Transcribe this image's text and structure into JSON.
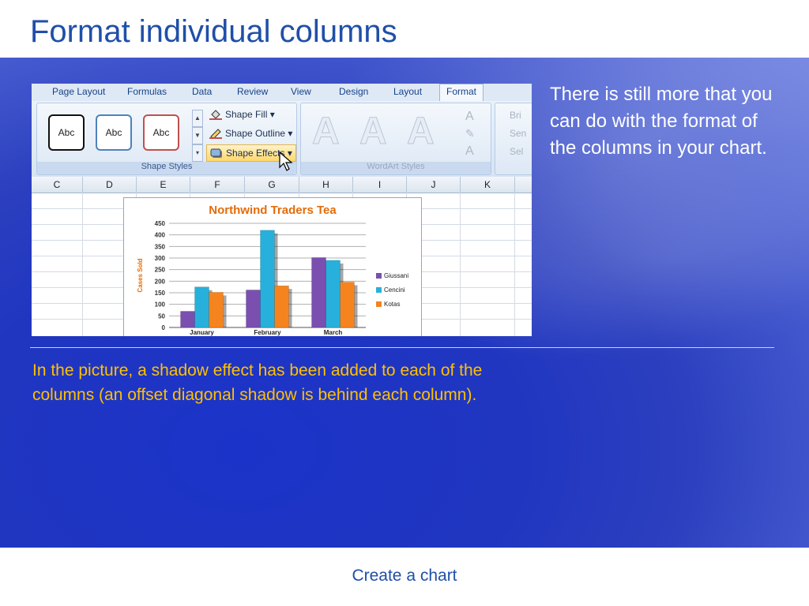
{
  "slide": {
    "title": "Format individual columns",
    "side_text": "There is still more that you can do with the format of the columns in your chart.",
    "caption": "In the picture, a shadow effect has been added to each of the columns (an offset diagonal shadow is behind each column).",
    "footer": "Create a chart"
  },
  "ribbon": {
    "tabs": [
      "Page Layout",
      "Formulas",
      "Data",
      "Review",
      "View",
      "Design",
      "Layout",
      "Format"
    ],
    "active_tab": "Format",
    "shape_style_samples": [
      "Abc",
      "Abc",
      "Abc"
    ],
    "shape_styles_label": "Shape Styles",
    "shape_fill": "Shape Fill",
    "shape_outline": "Shape Outline",
    "shape_effects": "Shape Effects",
    "wordart_label": "WordArt Styles",
    "wordart_letter": "A",
    "right_items": [
      "Bri",
      "Sen",
      "Sel"
    ]
  },
  "sheet": {
    "columns": [
      "C",
      "D",
      "E",
      "F",
      "G",
      "H",
      "I",
      "J",
      "K"
    ]
  },
  "chart_data": {
    "type": "bar",
    "title": "Northwind Traders Tea",
    "ylabel": "Cases Sold",
    "xlabel": "",
    "categories": [
      "January",
      "February",
      "March"
    ],
    "series": [
      {
        "name": "Giussani",
        "color": "#7a4fb0",
        "values": [
          70,
          162,
          302
        ]
      },
      {
        "name": "Cencini",
        "color": "#27b0dc",
        "values": [
          175,
          420,
          290
        ]
      },
      {
        "name": "Kotas",
        "color": "#f5841f",
        "values": [
          152,
          180,
          196
        ]
      }
    ],
    "ylim": [
      0,
      450
    ],
    "yticks": [
      "450",
      "400",
      "350",
      "300",
      "250",
      "200",
      "150",
      "100",
      "50",
      "0"
    ],
    "grid": true,
    "legend": "right"
  },
  "colors": {
    "title": "#1f4fa8",
    "caption": "#ffc000",
    "chart_title": "#e46c0a"
  }
}
